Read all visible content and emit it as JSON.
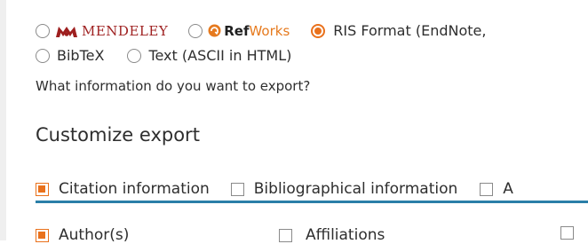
{
  "formats": {
    "mendeley": {
      "label": "MENDELEY",
      "selected": false
    },
    "refworks": {
      "label_bold": "Ref",
      "label_light": "Works",
      "selected": false
    },
    "ris": {
      "label": "RIS Format (EndNote,",
      "selected": true
    },
    "bibtex": {
      "label": "BibTeX",
      "selected": false
    },
    "text": {
      "label": "Text (ASCII in HTML)",
      "selected": false
    }
  },
  "question": "What information do you want to export?",
  "customize": {
    "heading": "Customize export",
    "tabs": [
      {
        "label": "Citation information",
        "checked": true
      },
      {
        "label": "Bibliographical information",
        "checked": false
      },
      {
        "label": "A",
        "checked": false
      }
    ],
    "fields": [
      {
        "label": "Author(s)",
        "checked": true
      },
      {
        "label": "Affiliations",
        "checked": false
      },
      {
        "label": "",
        "checked": false
      }
    ]
  },
  "colors": {
    "accent": "#e9711c",
    "tab_underline": "#2a7fa8",
    "mendeley_red": "#9e1f1f",
    "refworks_orange": "#e67a1e"
  }
}
